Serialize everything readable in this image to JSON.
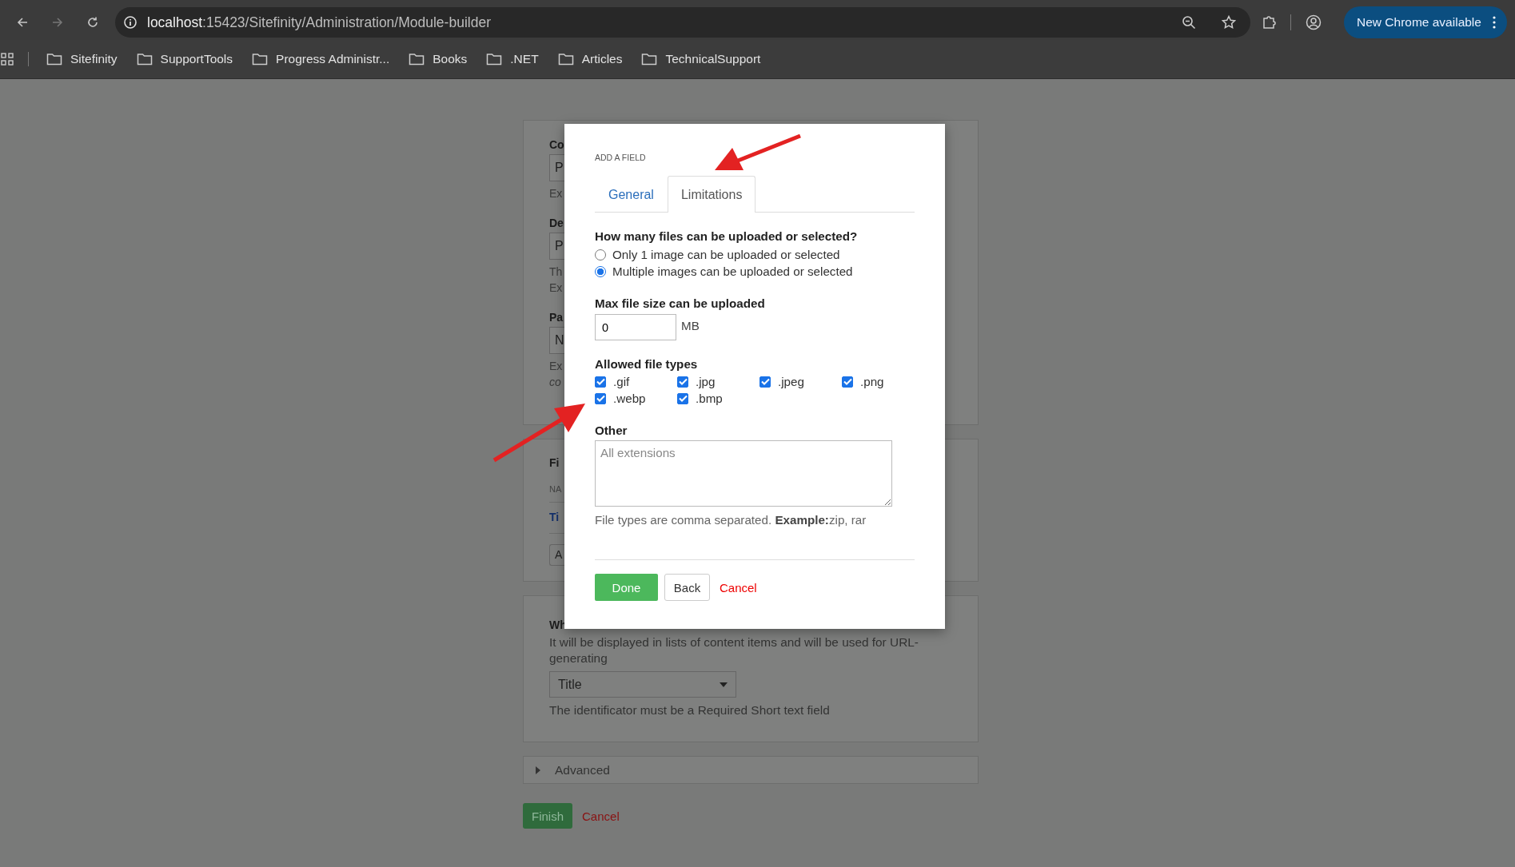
{
  "browser": {
    "url_host": "localhost",
    "url_rest": ":15423/Sitefinity/Administration/Module-builder",
    "update_button": "New Chrome available"
  },
  "bookmarks": [
    "Sitefinity",
    "SupportTools",
    "Progress Administr...",
    "Books",
    ".NET",
    "Articles",
    "TechnicalSupport"
  ],
  "background_page": {
    "cards": [
      {
        "fragments": [
          {
            "kind": "label",
            "text": "Co"
          },
          {
            "kind": "input",
            "text": "P"
          },
          {
            "kind": "hint",
            "text": "Ex"
          },
          {
            "kind": "label",
            "text": "De"
          },
          {
            "kind": "input",
            "text": "P"
          },
          {
            "kind": "hint",
            "text": "Th"
          },
          {
            "kind": "hint",
            "text": "Ex"
          },
          {
            "kind": "label",
            "text": "Pa"
          },
          {
            "kind": "input",
            "text": "N"
          },
          {
            "kind": "hint",
            "text": "Ex"
          },
          {
            "kind": "italic",
            "text": "co"
          }
        ]
      },
      {
        "fragments": [
          {
            "kind": "label",
            "text": "Fi"
          },
          {
            "kind": "header",
            "text": "NA"
          },
          {
            "kind": "link",
            "text": "Ti"
          },
          {
            "kind": "button",
            "text": "A"
          }
        ]
      },
      {
        "fragments": [
          {
            "kind": "label",
            "text": "Wh"
          },
          {
            "kind": "text",
            "text": "It will be displayed in lists of content items and will be used for URL-generating"
          },
          {
            "kind": "select",
            "text": "Title"
          },
          {
            "kind": "text",
            "text": "The identificator must be a Required Short text field"
          }
        ]
      }
    ],
    "advanced": {
      "label": "Advanced",
      "expanded": false
    },
    "finish_button": "Finish",
    "cancel_link": "Cancel"
  },
  "dialog": {
    "title": "ADD A FIELD",
    "tabs": [
      {
        "label": "General",
        "selected": false
      },
      {
        "label": "Limitations",
        "selected": true
      }
    ],
    "question": "How many files can be uploaded or selected?",
    "options": [
      {
        "label": "Only 1 image can be uploaded or selected",
        "selected": false
      },
      {
        "label": "Multiple images can be uploaded or selected",
        "selected": true
      }
    ],
    "max_size": {
      "label": "Max file size can be uploaded",
      "value": "0",
      "unit": "MB"
    },
    "file_types": {
      "label": "Allowed file types",
      "items": [
        {
          "label": ".gif",
          "checked": true
        },
        {
          "label": ".jpg",
          "checked": true
        },
        {
          "label": ".jpeg",
          "checked": true
        },
        {
          "label": ".png",
          "checked": true
        },
        {
          "label": ".webp",
          "checked": true
        },
        {
          "label": ".bmp",
          "checked": true
        }
      ]
    },
    "other": {
      "label": "Other",
      "placeholder": "All extensions"
    },
    "help": "File types are comma separated. **Example:**zip, rar",
    "buttons": [
      {
        "label": "Done",
        "kind": "primary"
      },
      {
        "label": "Back",
        "kind": "secondary"
      },
      {
        "label": "Cancel",
        "kind": "link"
      }
    ]
  }
}
